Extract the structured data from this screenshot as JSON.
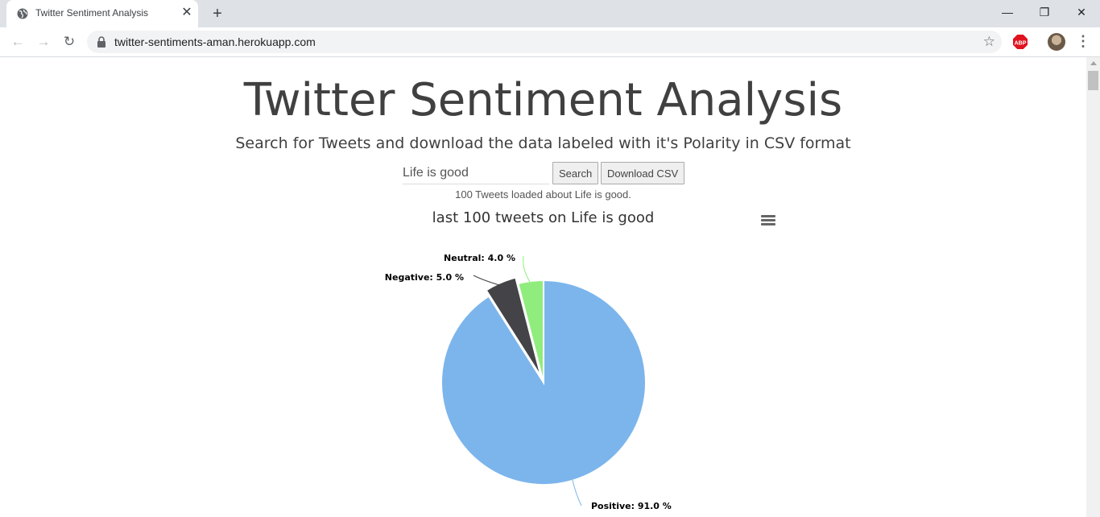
{
  "browser": {
    "tab_title": "Twitter Sentiment Analysis",
    "url": "twitter-sentiments-aman.herokuapp.com"
  },
  "page": {
    "title": "Twitter Sentiment Analysis",
    "subtitle": "Search for Tweets and download the data labeled with it's Polarity in CSV format",
    "search_value": "Life is good",
    "search_button": "Search",
    "download_button": "Download CSV",
    "status": "100 Tweets loaded about Life is good."
  },
  "chart_data": {
    "type": "pie",
    "title": "last 100 tweets on Life is good",
    "slices": [
      {
        "name": "Positive",
        "value": 91.0,
        "color": "#7cb5ec",
        "label": "Positive: 91.0 %"
      },
      {
        "name": "Negative",
        "value": 5.0,
        "color": "#434348",
        "label": "Negative: 5.0 %"
      },
      {
        "name": "Neutral",
        "value": 4.0,
        "color": "#90ed7d",
        "label": "Neutral: 4.0 %"
      }
    ]
  }
}
